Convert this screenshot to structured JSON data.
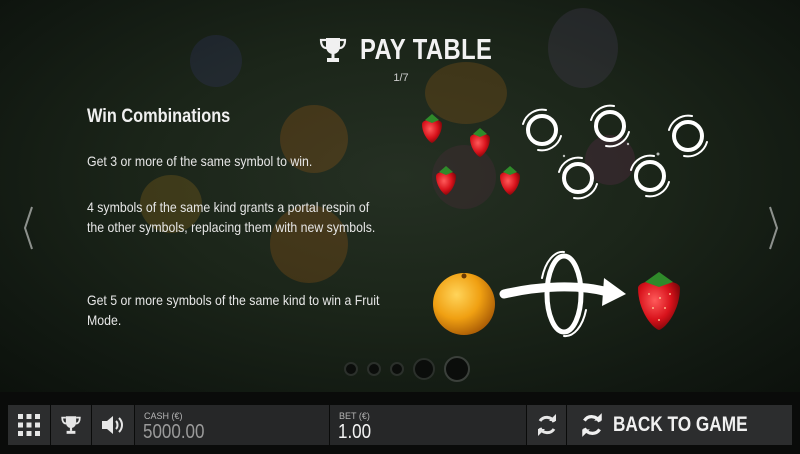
{
  "header": {
    "title": "PAY TABLE",
    "page_indicator": "1/7"
  },
  "content": {
    "heading": "Win Combinations",
    "paragraphs": [
      "Get 3 or more of the same symbol to win.",
      "4 symbols of the same kind grants a portal respin of the other symbols, replacing them with new symbols.",
      "Get 5 or more symbols of the same kind to win a Fruit Mode."
    ]
  },
  "pagination": {
    "total_dots": 5,
    "active_index": 4
  },
  "bottom_bar": {
    "cash_label": "CASH (€)",
    "cash_value": "5000.00",
    "bet_label": "BET (€)",
    "bet_value": "1.00",
    "back_label": "BACK TO GAME"
  },
  "icons": {
    "menu": "grid-menu-icon",
    "paytable": "trophy-icon",
    "sound": "speaker-icon",
    "autoplay": "refresh-icon",
    "back": "back-arrow-icon",
    "nav_prev": "chevron-left-icon",
    "nav_next": "chevron-right-icon"
  },
  "colors": {
    "background": "#1b2519",
    "bar_background": "#0a0b0a",
    "button_background": "#2c2d2e",
    "text": "#e9e9e9",
    "strawberry": "#d8121b",
    "orange": "#f0a012"
  }
}
